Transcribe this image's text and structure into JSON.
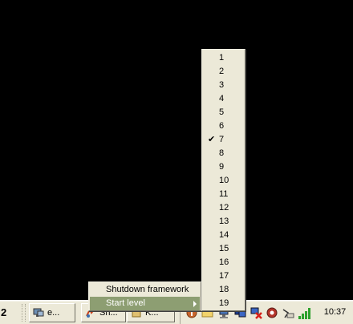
{
  "taskbar": {
    "partial_label": "2",
    "buttons": [
      {
        "label": "e...",
        "icon": "network-icon"
      },
      {
        "label": "Sh...",
        "icon": "knopflerfish-icon"
      },
      {
        "label": "K...",
        "icon": "app-icon"
      }
    ]
  },
  "tray": {
    "icons": [
      "shield-icon",
      "folder-icon",
      "network-icon",
      "display-icon",
      "network-error-icon",
      "settings-icon",
      "connection-icon",
      "signal-icon"
    ],
    "clock": "10:37"
  },
  "context_menu": {
    "items": [
      {
        "label": "Shutdown framework",
        "highlighted": false,
        "has_submenu": false
      },
      {
        "label": "Start level",
        "highlighted": true,
        "has_submenu": true
      }
    ]
  },
  "start_level_menu": {
    "items": [
      "1",
      "2",
      "3",
      "4",
      "5",
      "6",
      "7",
      "8",
      "9",
      "10",
      "11",
      "12",
      "13",
      "14",
      "15",
      "16",
      "17",
      "18",
      "19"
    ],
    "checked": "7",
    "check_glyph": "✔"
  }
}
